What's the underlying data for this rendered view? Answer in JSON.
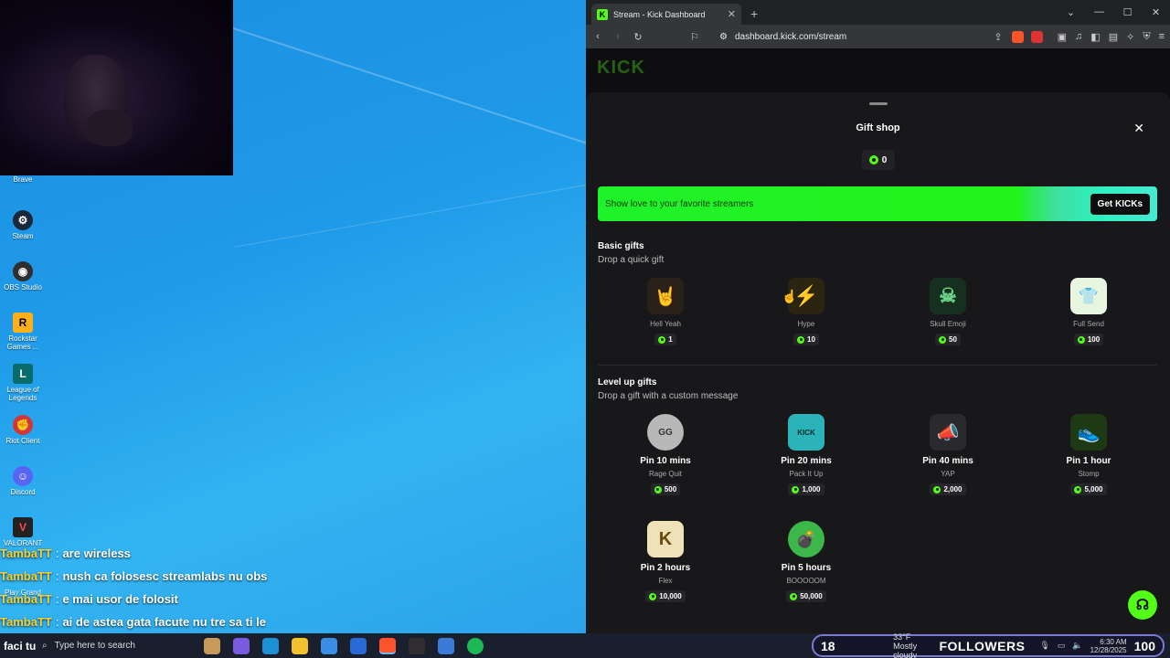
{
  "desktop": {
    "icons": [
      {
        "label": "Brave",
        "icon": "brave-icon",
        "color": "#fb542b"
      },
      {
        "label": "Steam",
        "icon": "steam-icon",
        "color": "#1b2838"
      },
      {
        "label": "OBS Studio",
        "icon": "obs-icon",
        "color": "#302e31"
      },
      {
        "label": "Rockstar Games ...",
        "icon": "rockstar-icon",
        "color": "#fcaf17"
      },
      {
        "label": "League of Legends",
        "icon": "league-icon",
        "color": "#0a6b6b"
      },
      {
        "label": "Riot Client",
        "icon": "riot-icon",
        "color": "#d13639"
      },
      {
        "label": "Discord",
        "icon": "discord-icon",
        "color": "#5865f2"
      },
      {
        "label": "VALORANT",
        "icon": "valorant-icon",
        "color": "#222"
      },
      {
        "label": "Play Grand",
        "icon": "gta-icon",
        "color": "#444"
      }
    ],
    "chat": [
      {
        "user": "TambaTT",
        "message": "are wireless"
      },
      {
        "user": "TambaTT",
        "message": "nush ca folosesc streamlabs nu obs"
      },
      {
        "user": "TambaTT",
        "message": "e mai usor de folosit"
      },
      {
        "user": "TambaTT",
        "message": "ai de astea gata facute nu tre sa ti le"
      }
    ]
  },
  "browser": {
    "tab_title": "Stream - Kick Dashboard",
    "url": "dashboard.kick.com/stream",
    "kick_logo": "KICK",
    "gift_shop": {
      "title": "Gift shop",
      "balance": "0",
      "banner_text": "Show love to your favorite streamers",
      "banner_button": "Get KICKs",
      "basic": {
        "title": "Basic gifts",
        "subtitle": "Drop a quick gift",
        "items": [
          {
            "name": "Hell Yeah",
            "price": "1",
            "icon": "rock-hand-icon",
            "color": "#e8b27a"
          },
          {
            "name": "Hype",
            "price": "10",
            "icon": "lightning-icon",
            "color": "#f2b51a"
          },
          {
            "name": "Skull Emoji",
            "price": "50",
            "icon": "skull-icon",
            "color": "#6fd68a"
          },
          {
            "name": "Full Send",
            "price": "100",
            "icon": "tshirt-icon",
            "color": "#e8f5e0"
          }
        ]
      },
      "level_up": {
        "title": "Level up gifts",
        "subtitle": "Drop a gift with a custom message",
        "items": [
          {
            "pin": "Pin 10 mins",
            "name": "Rage Quit",
            "price": "500",
            "icon": "gg-icon",
            "color": "#b8b8b8"
          },
          {
            "pin": "Pin 20 mins",
            "name": "Pack It Up",
            "price": "1,000",
            "icon": "suitcase-icon",
            "color": "#2ab3b8"
          },
          {
            "pin": "Pin 40 mins",
            "name": "YAP",
            "price": "2,000",
            "icon": "megaphone-icon",
            "color": "#dcdcdc"
          },
          {
            "pin": "Pin 1 hour",
            "name": "Stomp",
            "price": "5,000",
            "icon": "sneaker-icon",
            "color": "#53d62a"
          },
          {
            "pin": "Pin 2 hours",
            "name": "Flex",
            "price": "10,000",
            "icon": "flex-icon",
            "color": "#f0e2b8"
          },
          {
            "pin": "Pin 5 hours",
            "name": "BOOOOOM",
            "price": "50,000",
            "icon": "grenade-icon",
            "color": "#3cb84a"
          }
        ]
      }
    }
  },
  "taskbar": {
    "start_text": "faci tu",
    "search_placeholder": "Type here to search",
    "followers_count": "18",
    "weather": "33°F  Mostly cloudy",
    "followers_label": "FOLLOWERS",
    "time": "6:30 AM",
    "date": "12/28/2025",
    "followers_goal": "100"
  },
  "colors": {
    "kick_green": "#53fc18",
    "desktop_blue": "#1e9ae8",
    "chat_user": "#f7d032"
  }
}
